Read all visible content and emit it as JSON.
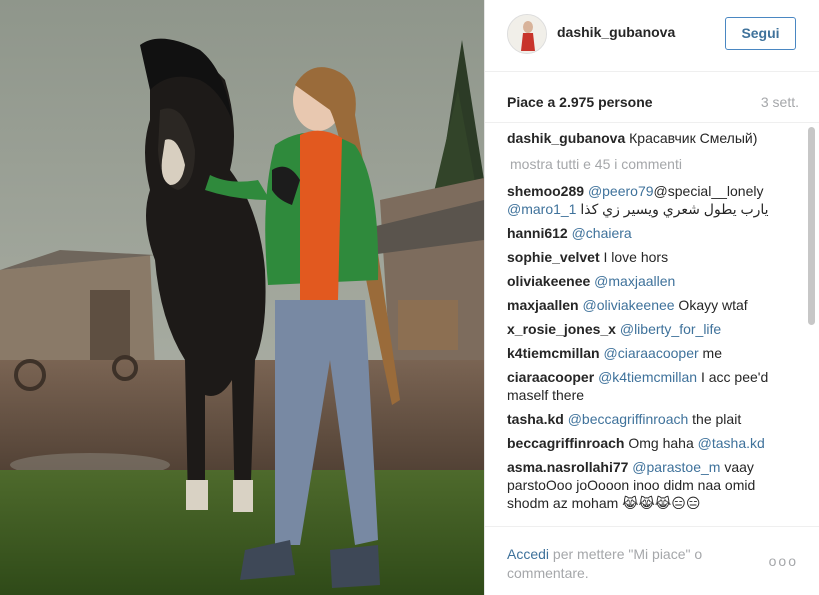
{
  "post": {
    "username": "dashik_gubanova",
    "follow_label": "Segui",
    "likes_text": "Piace a 2.975 persone",
    "age": "3 sett.",
    "caption": {
      "author": "dashik_gubanova",
      "text": "Красавчик Смелый)"
    },
    "show_all_label": "mostra tutti e 45 i commenti"
  },
  "comments": [
    {
      "author": "shemoo289",
      "mention": "@peero79",
      "text": "@special__lonely",
      "mention2": "@maro1_1",
      "text2": " يارب يطول شعري ويسير زي كذا"
    },
    {
      "author": "hanni612",
      "mention": "@chaiera",
      "text": ""
    },
    {
      "author": "sophie_velvet",
      "mention": "",
      "text": "I love hors"
    },
    {
      "author": "oliviakeenee",
      "mention": "@maxjaallen",
      "text": ""
    },
    {
      "author": "maxjaallen",
      "mention": "@oliviakeenee",
      "text": " Okayy wtaf"
    },
    {
      "author": "x_rosie_jones_x",
      "mention": "@liberty_for_life",
      "text": ""
    },
    {
      "author": "k4tiemcmillan",
      "mention": "@ciaraacooper",
      "text": " me"
    },
    {
      "author": "ciaraacooper",
      "mention": "@k4tiemcmillan",
      "text": " I acc pee'd maself there"
    },
    {
      "author": "tasha.kd",
      "mention": "@beccagriffinroach",
      "text": " the plait"
    },
    {
      "author": "beccagriffinroach",
      "mention": "",
      "text": "Omg haha ",
      "mention2": "@tasha.kd",
      "text2": ""
    },
    {
      "author": "asma.nasrollahi77",
      "mention": "@parastoe_m",
      "text": " vaay parstoOoo joOooon inoo didm naa omid shodm az moham 😹😹😹😑😑"
    }
  ],
  "footer": {
    "login_link": "Accedi",
    "login_text": " per mettere \"Mi piace\" o commentare.",
    "more_icon": "ooo"
  },
  "colors": {
    "link": "#3f729b",
    "muted": "#a5a7aa",
    "button_border": "#4a87c2"
  }
}
